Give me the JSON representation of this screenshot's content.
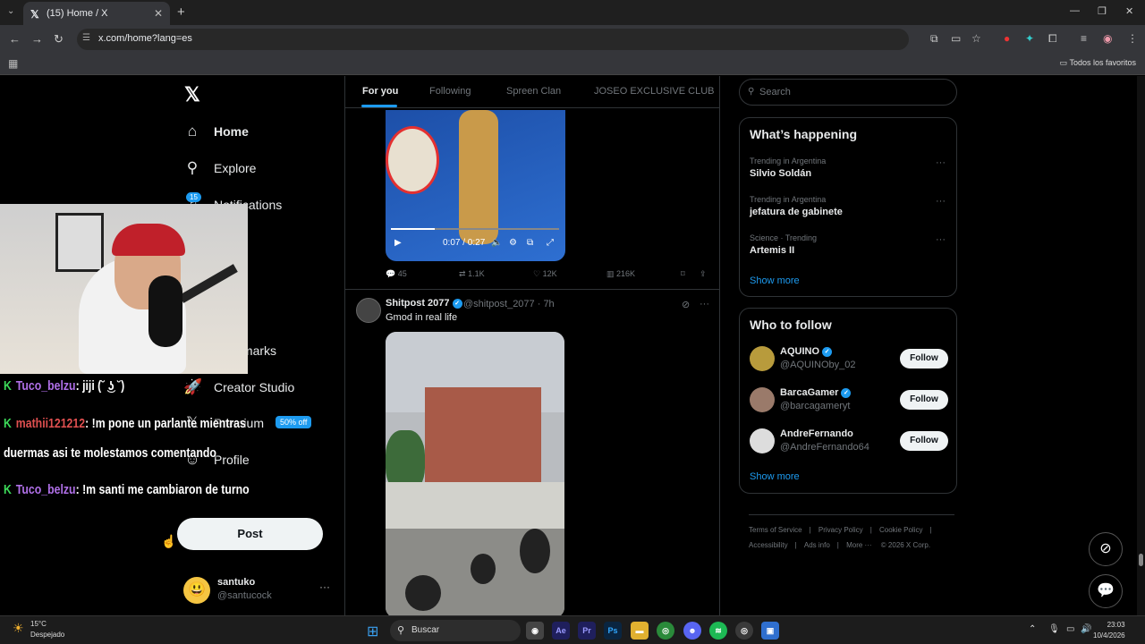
{
  "browser": {
    "tab_title": "(15) Home / X",
    "url": "x.com/home?lang=es",
    "bookmarks_label": "Todos los favoritos"
  },
  "sidebar": {
    "nav": [
      {
        "label": "Home",
        "icon": "home-icon"
      },
      {
        "label": "Explore",
        "icon": "search-icon"
      },
      {
        "label": "Notifications",
        "icon": "bell-icon"
      },
      {
        "label": "Bookmarks",
        "icon": "bookmark-icon"
      },
      {
        "label": "Creator Studio",
        "icon": "rocket-icon"
      },
      {
        "label": "Premium",
        "icon": "x-premium-icon"
      },
      {
        "label": "Profile",
        "icon": "person-icon"
      }
    ],
    "notifications_badge": "15",
    "premium_badge": "50% off",
    "post_label": "Post",
    "account": {
      "name": "santuko",
      "handle": "@santucock"
    }
  },
  "chat_overlay": [
    {
      "user": "Tuco_belzu",
      "text": ": jiji (˘ ͜ʖ ˘)"
    },
    {
      "user": "mathii121212",
      "text": ": !m pone un parlante mientras"
    },
    {
      "user": "",
      "text": "duermas asi te molestamos comentando"
    },
    {
      "user": "Tuco_belzu",
      "text": ": !m santi me cambiaron de turno"
    }
  ],
  "feed": {
    "tabs": [
      "For you",
      "Following",
      "Spreen Clan",
      "JOSEO EXCLUSIVE CLUB"
    ],
    "active_tab": "For you",
    "post1": {
      "video_time": "0:07 / 0:27",
      "progress": 0.26,
      "stats": {
        "replies": "45",
        "reposts": "1.1K",
        "likes": "12K",
        "views": "216K"
      }
    },
    "post2": {
      "name": "Shitpost 2077",
      "handle": "@shitpost_2077 · 7h",
      "text": "Gmod in real life"
    }
  },
  "right": {
    "search_placeholder": "Search",
    "happening_title": "What’s happening",
    "trends": [
      {
        "context": "Trending in Argentina",
        "title": "Silvio Soldán"
      },
      {
        "context": "Trending in Argentina",
        "title": "jefatura de gabinete"
      },
      {
        "context": "Science · Trending",
        "title": "Artemis II"
      }
    ],
    "show_more": "Show more",
    "wtf_title": "Who to follow",
    "follow_label": "Follow",
    "who_to_follow": [
      {
        "name": "AQUINO",
        "handle": "@AQUINOby_02"
      },
      {
        "name": "BarcaGamer",
        "handle": "@barcagameryt"
      },
      {
        "name": "AndreFernando",
        "handle": "@AndreFernando64"
      }
    ],
    "footer": [
      "Terms of Service",
      "Privacy Policy",
      "Cookie Policy",
      "Accessibility",
      "Ads info",
      "More ···",
      "© 2026 X Corp."
    ]
  },
  "taskbar": {
    "temp": "15°C",
    "weather": "Despejado",
    "search": "Buscar",
    "time": "23:03",
    "date": "10/4/2026"
  }
}
